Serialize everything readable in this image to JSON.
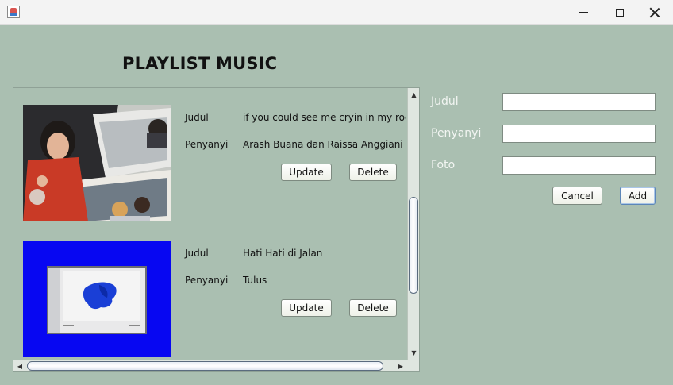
{
  "window": {
    "minimize_icon": "minimize-icon",
    "maximize_icon": "maximize-icon",
    "close_icon": "close-icon",
    "app_icon": "java-app-icon"
  },
  "page": {
    "title": "PLAYLIST MUSIC",
    "background_color": "#aabfb1"
  },
  "playlist": {
    "items": [
      {
        "judul_label": "Judul",
        "judul": "if you could see me cryin in my room",
        "penyanyi_label": "Penyanyi",
        "penyanyi": "Arash Buana dan Raissa Anggiani",
        "cover": "photo-collage",
        "update_label": "Update",
        "delete_label": "Delete"
      },
      {
        "judul_label": "Judul",
        "judul": "Hati Hati di Jalan",
        "penyanyi_label": "Penyanyi",
        "penyanyi": "Tulus",
        "cover": "blue-album-art",
        "update_label": "Update",
        "delete_label": "Delete"
      }
    ]
  },
  "form": {
    "judul_label": "Judul",
    "judul_value": "",
    "penyanyi_label": "Penyanyi",
    "penyanyi_value": "",
    "foto_label": "Foto",
    "foto_value": "",
    "cancel_label": "Cancel",
    "add_label": "Add"
  }
}
